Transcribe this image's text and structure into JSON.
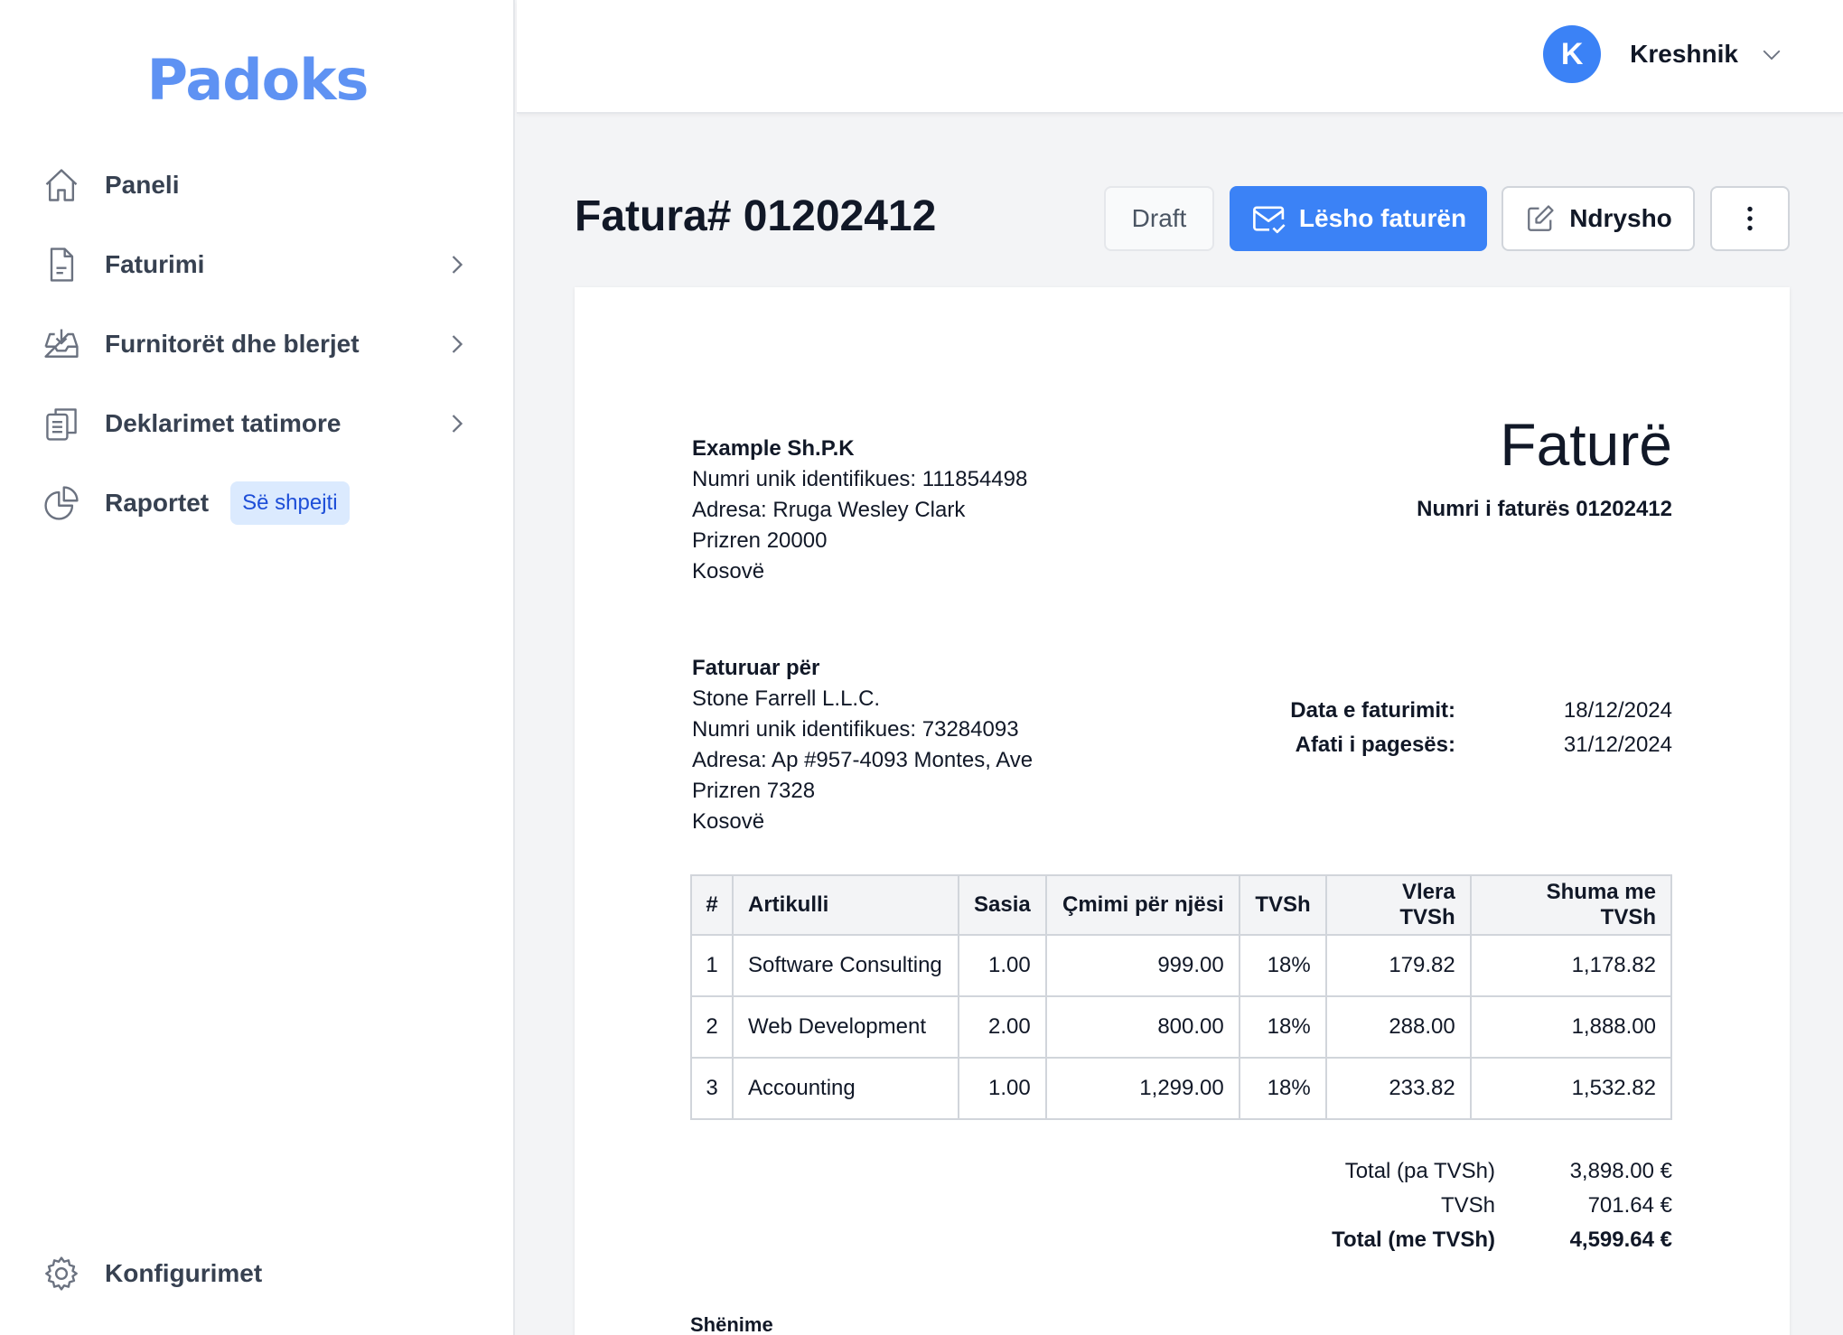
{
  "app": {
    "logo": "Padoks"
  },
  "sidebar": {
    "items": [
      {
        "label": "Paneli",
        "icon": "home-icon"
      },
      {
        "label": "Faturimi",
        "icon": "document-icon"
      },
      {
        "label": "Furnitorët dhe blerjet",
        "icon": "inbox-icon"
      },
      {
        "label": "Deklarimet tatimore",
        "icon": "clipboard-icon"
      },
      {
        "label": "Raportet",
        "icon": "pie-chart-icon",
        "badge": "Së shpejti"
      }
    ],
    "settings_label": "Konfigurimet"
  },
  "user": {
    "initial": "K",
    "name": "Kreshnik"
  },
  "header": {
    "title": "Fatura# 01202412",
    "status": "Draft",
    "issue_label": "Lësho faturën",
    "edit_label": "Ndrysho"
  },
  "invoice": {
    "from": {
      "name": "Example Sh.P.K",
      "id_line": "Numri unik identifikues: 111854498",
      "address": "Adresa: Rruga Wesley Clark",
      "city": "Prizren 20000",
      "country": "Kosovë"
    },
    "doc_title": "Faturë",
    "doc_number": "Numri i faturës 01202412",
    "to": {
      "heading": "Faturuar për",
      "name": "Stone Farrell L.L.C.",
      "id_line": "Numri unik identifikues: 73284093",
      "address": "Adresa: Ap #957-4093 Montes, Ave",
      "city": "Prizren 7328",
      "country": "Kosovë"
    },
    "dates": {
      "issue_label": "Data e faturimit:",
      "issue_value": "18/12/2024",
      "due_label": "Afati i pagesës:",
      "due_value": "31/12/2024"
    },
    "table": {
      "headers": [
        "#",
        "Artikulli",
        "Sasia",
        "Çmimi për njësi",
        "TVSh",
        "Vlera TVSh",
        "Shuma me TVSh"
      ],
      "rows": [
        [
          "1",
          "Software Consulting",
          "1.00",
          "999.00",
          "18%",
          "179.82",
          "1,178.82"
        ],
        [
          "2",
          "Web Development",
          "2.00",
          "800.00",
          "18%",
          "288.00",
          "1,888.00"
        ],
        [
          "3",
          "Accounting",
          "1.00",
          "1,299.00",
          "18%",
          "233.82",
          "1,532.82"
        ]
      ]
    },
    "totals": {
      "subtotal_label": "Total (pa TVSh)",
      "subtotal_value": "3,898.00 €",
      "vat_label": "TVSh",
      "vat_value": "701.64 €",
      "total_label": "Total (me TVSh)",
      "total_value": "4,599.64 €"
    },
    "notes_label": "Shënime"
  },
  "colors": {
    "accent": "#3b82f6",
    "logo": "#5e92f3",
    "badge_bg": "#dbeafe"
  }
}
